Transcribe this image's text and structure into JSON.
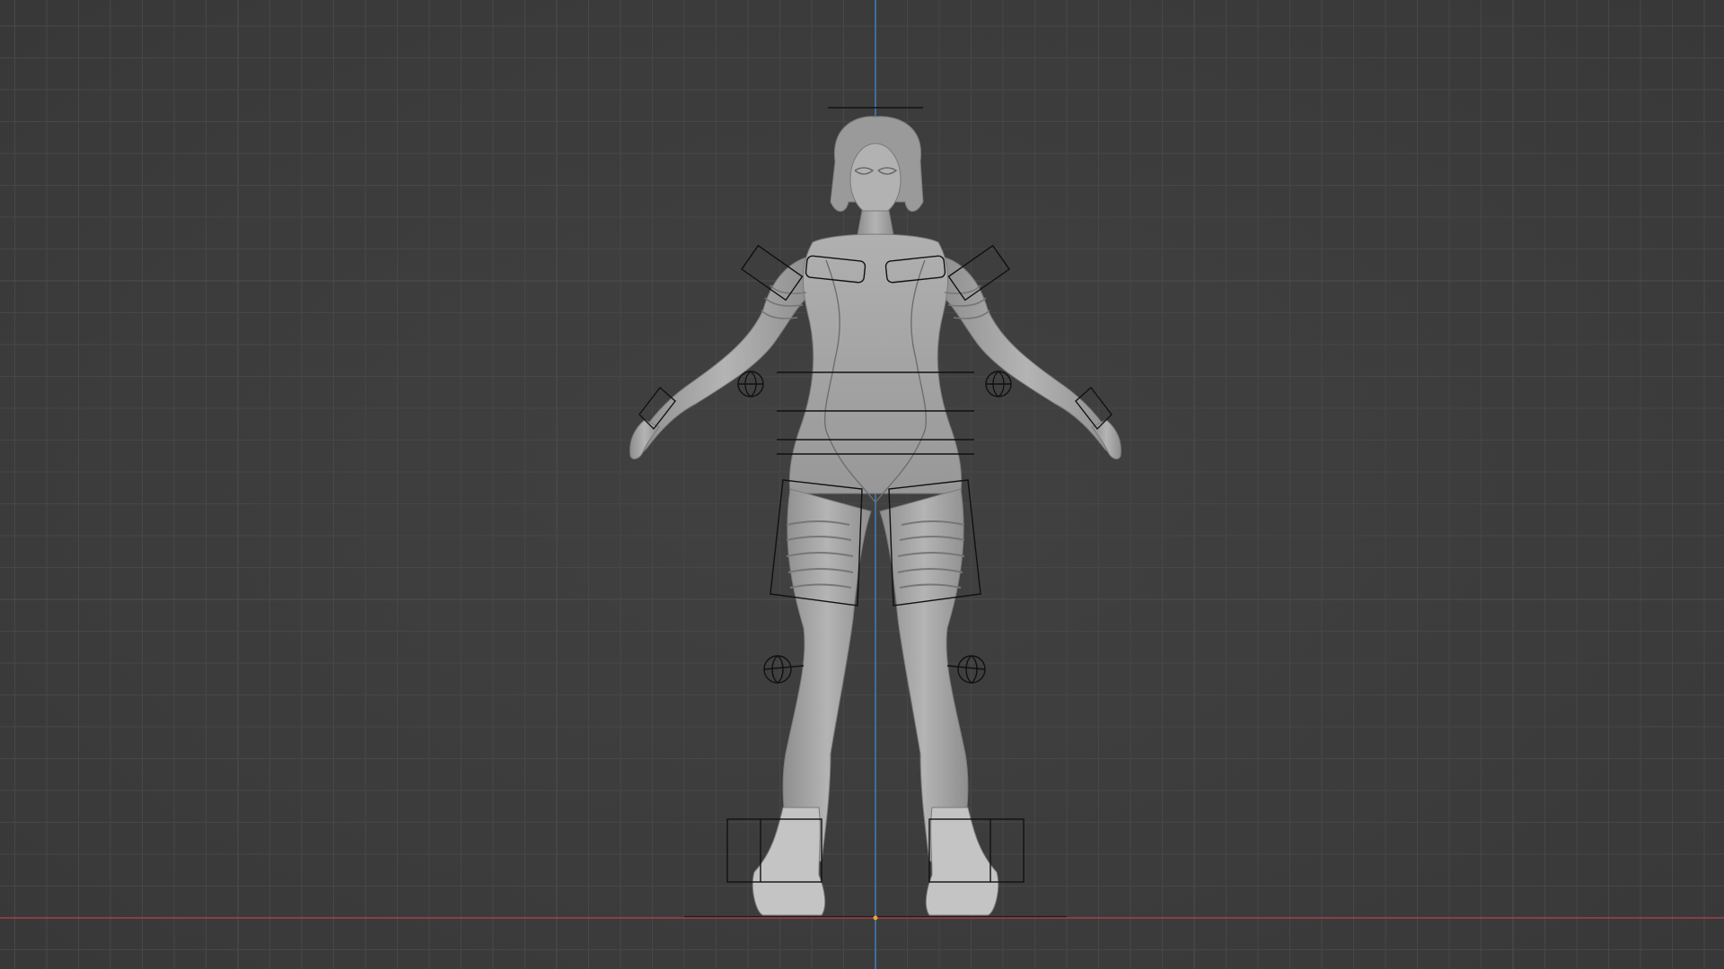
{
  "app": "3D viewport",
  "view": {
    "orientation": "front-orthographic",
    "shading": "solid",
    "grid": true,
    "axes_visible": [
      "x",
      "z"
    ]
  },
  "colors": {
    "background": "#3d3d3d",
    "grid_minor": "#474747",
    "grid_major": "#4e4e4e",
    "x_axis": "#a4414c",
    "z_axis": "#3f7fb8",
    "mesh": "#a8a8a8",
    "rig_controls": "#111111",
    "origin": "#f0a030"
  },
  "scene": {
    "model": "female-character-a-pose",
    "controls": [
      "head-control",
      "shoulder-control-left",
      "shoulder-control-right",
      "elbow-pole-left",
      "elbow-pole-right",
      "torso-controls",
      "hand-control-left",
      "hand-control-right",
      "thigh-control-left",
      "thigh-control-right",
      "knee-pole-left",
      "knee-pole-right",
      "foot-control-left",
      "foot-control-right",
      "root-control"
    ]
  }
}
